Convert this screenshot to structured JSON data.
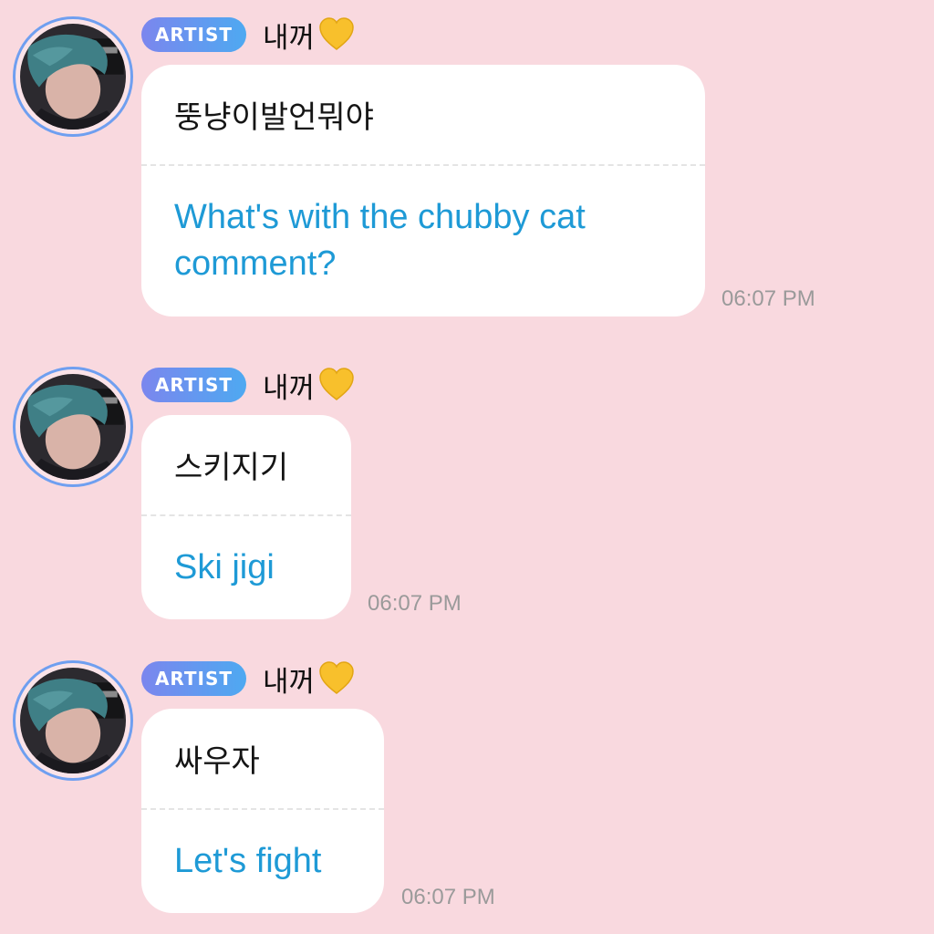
{
  "messages": [
    {
      "badge": "ARTIST",
      "name": "내꺼",
      "original": "뚱냥이발언뭐야",
      "translation": "What's with the chubby cat comment?",
      "time": "06:07 PM"
    },
    {
      "badge": "ARTIST",
      "name": "내꺼",
      "original": "스키지기",
      "translation": "Ski jigi",
      "time": "06:07 PM"
    },
    {
      "badge": "ARTIST",
      "name": "내꺼",
      "original": "싸우자",
      "translation": "Let's fight",
      "time": "06:07 PM"
    }
  ],
  "icons": {
    "heart": "yellow-heart-icon"
  },
  "colors": {
    "background": "#f9d9df",
    "badge_start": "#7b86ee",
    "badge_end": "#4ea9f1",
    "avatar_ring": "#6f9ff0",
    "translation_text": "#1e9ad6",
    "timestamp": "#9a9a9a",
    "heart": "#f8c02c"
  }
}
